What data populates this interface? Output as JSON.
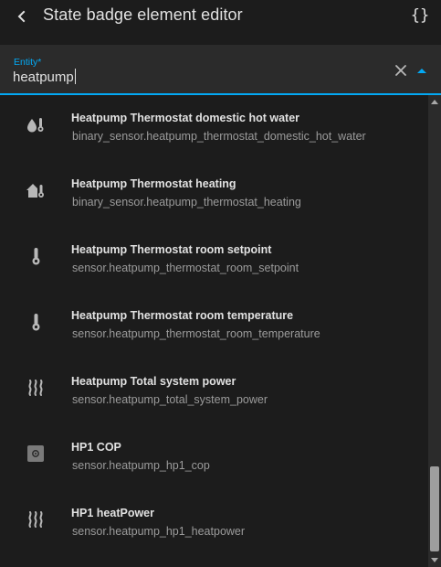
{
  "header": {
    "title": "State badge element editor",
    "back_icon": "chevron-left-icon",
    "code_label": "{}"
  },
  "entity_field": {
    "label": "Entity*",
    "value": "heatpump",
    "accent_color": "#03a9f4"
  },
  "items": [
    {
      "name": "Heatpump Thermostat domestic hot water",
      "entity_id": "binary_sensor.heatpump_thermostat_domestic_hot_water",
      "icon": "water-thermometer-icon"
    },
    {
      "name": "Heatpump Thermostat heating",
      "entity_id": "binary_sensor.heatpump_thermostat_heating",
      "icon": "home-thermometer-icon"
    },
    {
      "name": "Heatpump Thermostat room setpoint",
      "entity_id": "sensor.heatpump_thermostat_room_setpoint",
      "icon": "thermometer-icon"
    },
    {
      "name": "Heatpump Thermostat room temperature",
      "entity_id": "sensor.heatpump_thermostat_room_temperature",
      "icon": "thermometer-icon"
    },
    {
      "name": "Heatpump Total system power",
      "entity_id": "sensor.heatpump_total_system_power",
      "icon": "heat-waves-icon"
    },
    {
      "name": "HP1 COP",
      "entity_id": "sensor.heatpump_hp1_cop",
      "icon": "sensor-chip-icon"
    },
    {
      "name": "HP1 heatPower",
      "entity_id": "sensor.heatpump_hp1_heatpower",
      "icon": "heat-waves-icon"
    }
  ],
  "scrollbar": {
    "position_fraction": 0.79
  }
}
